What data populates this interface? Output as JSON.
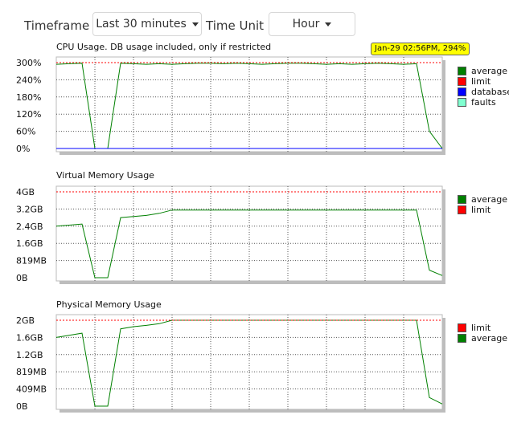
{
  "controls": {
    "timeframe_label": "Timeframe",
    "timeframe_value": "Last 30 minutes",
    "timeunit_label": "Time Unit",
    "timeunit_value": "Hour"
  },
  "tooltip": "Jan-29 02:56PM, 294%",
  "colors": {
    "average": "#008000",
    "limit": "#ff0000",
    "database": "#0000ff",
    "faults": "#80ffd0"
  },
  "chart_data": [
    {
      "type": "line",
      "title": "CPU Usage. DB usage included, only if restricted",
      "ylim": [
        0,
        300
      ],
      "yticks": [
        "300%",
        "240%",
        "180%",
        "120%",
        "60%",
        "0%"
      ],
      "x": [
        0,
        1,
        2,
        3,
        4,
        5,
        6,
        7,
        8,
        9,
        10,
        11,
        12,
        13,
        14,
        15,
        16,
        17,
        18,
        19,
        20,
        21,
        22,
        23,
        24,
        25,
        26,
        27,
        28,
        29,
        30
      ],
      "legend": [
        {
          "key": "average",
          "label": "average"
        },
        {
          "key": "limit",
          "label": "limit"
        },
        {
          "key": "database",
          "label": "database"
        },
        {
          "key": "faults",
          "label": "faults"
        }
      ],
      "series": [
        {
          "name": "average",
          "color": "#008000",
          "values": [
            294,
            296,
            298,
            0,
            0,
            298,
            296,
            294,
            296,
            294,
            296,
            298,
            298,
            296,
            298,
            296,
            294,
            296,
            298,
            298,
            296,
            294,
            296,
            294,
            296,
            298,
            296,
            294,
            296,
            60,
            0
          ]
        },
        {
          "name": "limit",
          "color": "#ff0000",
          "dashed": true,
          "values": "constant",
          "constant": 300
        },
        {
          "name": "database",
          "color": "#0000ff",
          "values": "constant",
          "constant": 0
        }
      ]
    },
    {
      "type": "line",
      "title": "Virtual Memory Usage",
      "ylim": [
        0,
        4
      ],
      "yticks": [
        "4GB",
        "3.2GB",
        "2.4GB",
        "1.6GB",
        "819MB",
        "0B"
      ],
      "legend": [
        {
          "key": "average",
          "label": "average"
        },
        {
          "key": "limit",
          "label": "limit"
        }
      ],
      "series": [
        {
          "name": "average",
          "color": "#008000",
          "values": [
            2.4,
            2.45,
            2.5,
            0,
            0,
            2.8,
            2.85,
            2.9,
            3.0,
            3.15,
            3.15,
            3.15,
            3.15,
            3.15,
            3.15,
            3.15,
            3.15,
            3.15,
            3.15,
            3.15,
            3.15,
            3.15,
            3.15,
            3.15,
            3.15,
            3.15,
            3.15,
            3.15,
            3.15,
            0.35,
            0.1
          ]
        },
        {
          "name": "limit",
          "color": "#ff0000",
          "dashed": true,
          "values": "constant",
          "constant": 4
        }
      ]
    },
    {
      "type": "line",
      "title": "Physical Memory Usage",
      "ylim": [
        0,
        2
      ],
      "yticks": [
        "2GB",
        "1.6GB",
        "1.2GB",
        "819MB",
        "409MB",
        "0B"
      ],
      "legend": [
        {
          "key": "limit",
          "label": "limit"
        },
        {
          "key": "average",
          "label": "average"
        }
      ],
      "series": [
        {
          "name": "average",
          "color": "#008000",
          "values": [
            1.6,
            1.65,
            1.7,
            0,
            0,
            1.8,
            1.85,
            1.88,
            1.92,
            2.0,
            2.0,
            2.0,
            2.0,
            2.0,
            2.0,
            2.0,
            2.0,
            2.0,
            2.0,
            2.0,
            2.0,
            2.0,
            2.0,
            2.0,
            2.0,
            2.0,
            2.0,
            2.0,
            2.0,
            0.2,
            0.05
          ]
        },
        {
          "name": "limit",
          "color": "#ff0000",
          "dashed": true,
          "values": "constant",
          "constant": 2
        }
      ]
    }
  ]
}
